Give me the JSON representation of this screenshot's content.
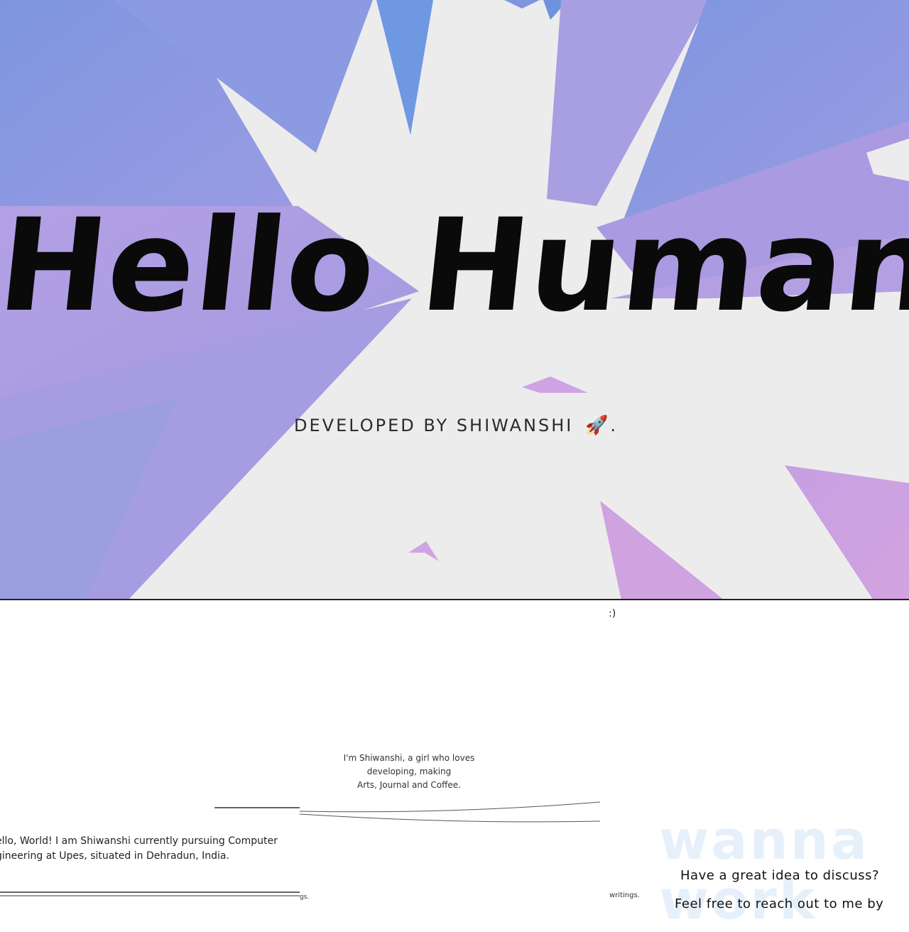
{
  "hero": {
    "title": "Hello Human!",
    "subtitle": "DEVELOPED BY SHIWANSHI",
    "subtitle_suffix": ".",
    "rocket_icon": "rocket-icon",
    "colors": {
      "background": "#ececec",
      "blue": "#7c98e0",
      "lavender": "#a99ee2",
      "pink": "#c79ee0"
    }
  },
  "smile": ":)",
  "intro": {
    "line1": "I'm Shiwanshi, a girl who loves",
    "line2": "developing, making",
    "line3": "Arts, Journal and Coffee."
  },
  "about": {
    "line1": "ello, World! I am Shiwanshi currently pursuing Computer",
    "line2": "gineering at Upes, situated in Dehradun, India."
  },
  "fragments": {
    "gs": "gs.",
    "writings": "writings."
  },
  "contact": {
    "watermark_line1": "wanna",
    "watermark_line2": "work",
    "question": "Have a great idea to discuss?",
    "reach_out": "Feel free to reach out to me by"
  }
}
